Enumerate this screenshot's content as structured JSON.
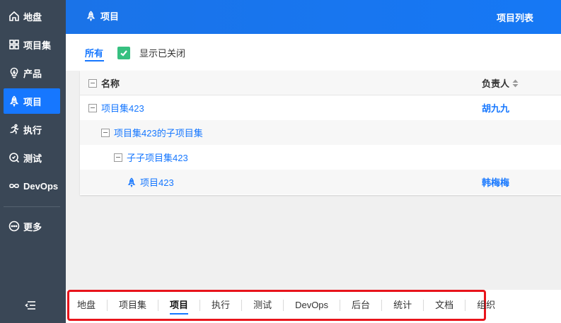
{
  "sidebar": {
    "items": [
      {
        "label": "地盘",
        "icon": "home-icon"
      },
      {
        "label": "项目集",
        "icon": "grid-icon"
      },
      {
        "label": "产品",
        "icon": "bulb-icon"
      },
      {
        "label": "项目",
        "icon": "rocket-icon",
        "active": true
      },
      {
        "label": "执行",
        "icon": "run-icon"
      },
      {
        "label": "测试",
        "icon": "search-icon"
      },
      {
        "label": "DevOps",
        "icon": "infinity-icon"
      },
      {
        "label": "更多",
        "icon": "more-icon"
      }
    ],
    "collapse_icon": "menu-collapse-icon"
  },
  "header": {
    "title": "项目",
    "right_link": "项目列表"
  },
  "filter": {
    "tab_all": "所有",
    "show_closed_label": "显示已关闭",
    "show_closed_checked": true
  },
  "table": {
    "col_name": "名称",
    "col_owner": "负责人",
    "rows": [
      {
        "name": "项目集423",
        "owner": "胡九九"
      },
      {
        "name": "项目集423的子项目集",
        "owner": ""
      },
      {
        "name": "子子项目集423",
        "owner": ""
      },
      {
        "name": "项目423",
        "owner": "韩梅梅"
      }
    ]
  },
  "bottom_nav": {
    "items": [
      "地盘",
      "项目集",
      "项目",
      "执行",
      "测试",
      "DevOps",
      "后台",
      "统计",
      "文档",
      "组织"
    ],
    "active": "项目"
  },
  "colors": {
    "sidebar_bg": "#3a4756",
    "accent": "#1677ff",
    "checkbox": "#36c080",
    "highlight_border": "#e8141b"
  }
}
